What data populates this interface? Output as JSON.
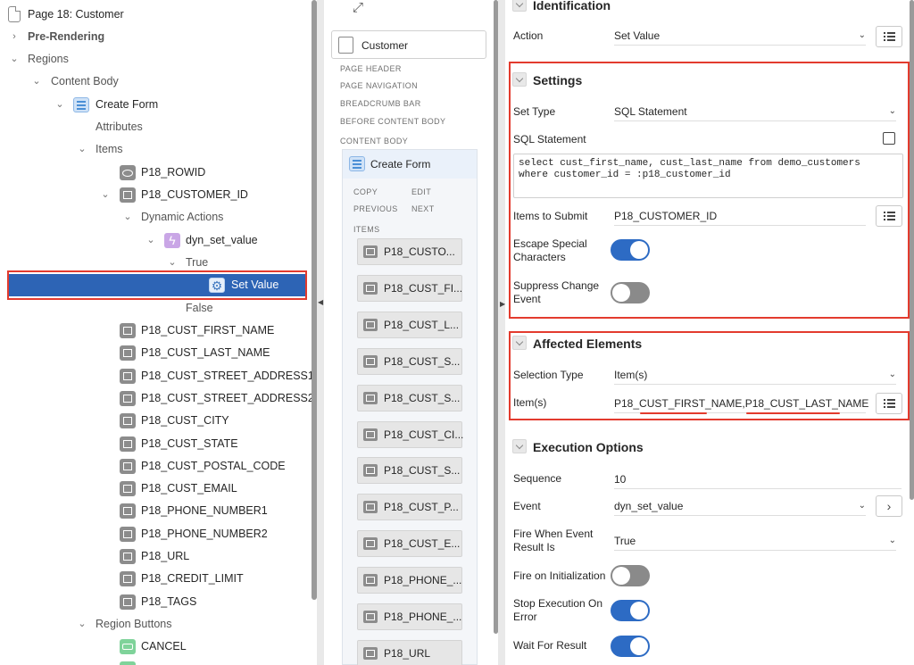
{
  "tree": {
    "page": "Page 18: Customer",
    "pre_rendering": "Pre-Rendering",
    "regions": "Regions",
    "content_body": "Content Body",
    "create_form": "Create Form",
    "attributes": "Attributes",
    "items_label": "Items",
    "rowid": "P18_ROWID",
    "customer_id": "P18_CUSTOMER_ID",
    "dynamic_actions": "Dynamic Actions",
    "dyn_set_value": "dyn_set_value",
    "true_label": "True",
    "set_value": "Set Value",
    "false_label": "False",
    "items": [
      "P18_CUST_FIRST_NAME",
      "P18_CUST_LAST_NAME",
      "P18_CUST_STREET_ADDRESS1",
      "P18_CUST_STREET_ADDRESS2",
      "P18_CUST_CITY",
      "P18_CUST_STATE",
      "P18_CUST_POSTAL_CODE",
      "P18_CUST_EMAIL",
      "P18_PHONE_NUMBER1",
      "P18_PHONE_NUMBER2",
      "P18_URL",
      "P18_CREDIT_LIMIT",
      "P18_TAGS"
    ],
    "region_buttons": "Region Buttons",
    "cancel": "CANCEL"
  },
  "layout": {
    "customer": "Customer",
    "sections": [
      "PAGE HEADER",
      "PAGE NAVIGATION",
      "BREADCRUMB BAR",
      "BEFORE CONTENT BODY",
      "CONTENT BODY"
    ],
    "create_form": "Create Form",
    "slots": [
      "COPY",
      "EDIT",
      "PREVIOUS",
      "NEXT"
    ],
    "items_label": "ITEMS",
    "cards": [
      "P18_CUSTO...",
      "P18_CUST_FI...",
      "P18_CUST_L...",
      "P18_CUST_S...",
      "P18_CUST_S...",
      "P18_CUST_CI...",
      "P18_CUST_S...",
      "P18_CUST_P...",
      "P18_CUST_E...",
      "P18_PHONE_...",
      "P18_PHONE_...",
      "P18_URL"
    ]
  },
  "props": {
    "identification": {
      "title": "Identification",
      "action_label": "Action",
      "action_value": "Set Value"
    },
    "settings": {
      "title": "Settings",
      "set_type_label": "Set Type",
      "set_type_value": "SQL Statement",
      "sql_label": "SQL Statement",
      "sql_value": "select cust_first_name, cust_last_name from demo_customers\nwhere customer_id = :p18_customer_id",
      "submit_label": "Items to Submit",
      "submit_value": "P18_CUSTOMER_ID",
      "escape_label": "Escape Special Characters",
      "escape_on": true,
      "suppress_label": "Suppress Change Event",
      "suppress_on": false
    },
    "affected": {
      "title": "Affected Elements",
      "selection_label": "Selection Type",
      "selection_value": "Item(s)",
      "items_label": "Item(s)",
      "items_value": "P18_CUST_FIRST_NAME,P18_CUST_LAST_NAME"
    },
    "execution": {
      "title": "Execution Options",
      "sequence_label": "Sequence",
      "sequence_value": "10",
      "event_label": "Event",
      "event_value": "dyn_set_value",
      "fire_label": "Fire When Event Result Is",
      "fire_value": "True",
      "init_label": "Fire on Initialization",
      "init_on": false,
      "stop_label": "Stop Execution On Error",
      "stop_on": true,
      "wait_label": "Wait For Result",
      "wait_on": true
    }
  },
  "colors": {
    "selected": "#2d64b5",
    "highlight": "#e33b2e",
    "toggle_on": "#2d6bc4",
    "toggle_off": "#8a8a8a"
  }
}
